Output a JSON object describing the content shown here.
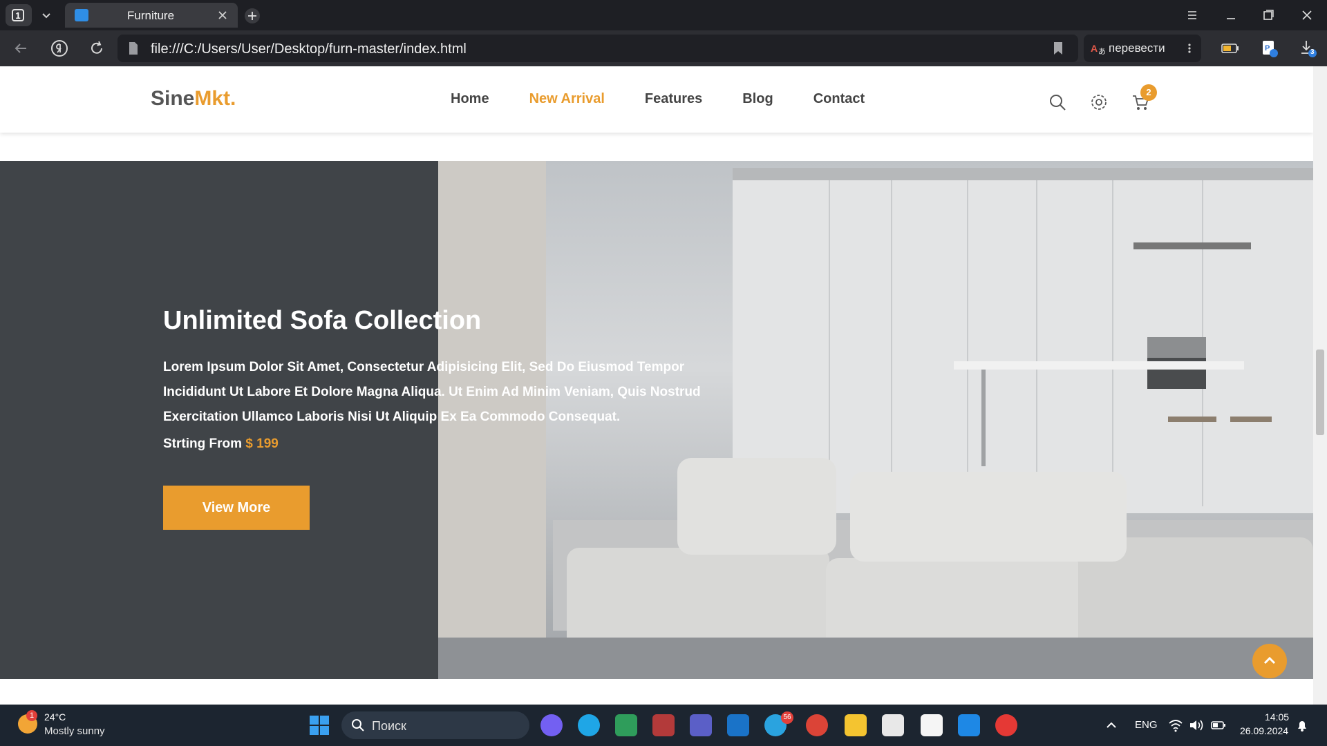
{
  "browser": {
    "tab_count": "1",
    "tab_title": "Furniture",
    "url": "file:///C:/Users/User/Desktop/furn-master/index.html",
    "translate_label": "перевести",
    "download_count": "3"
  },
  "site": {
    "logo_main": "Sine",
    "logo_accent": "Mkt",
    "logo_dot": ".",
    "nav": [
      "Home",
      "New Arrival",
      "Features",
      "Blog",
      "Contact"
    ],
    "active_nav": "New Arrival",
    "cart_count": "2"
  },
  "hero": {
    "title": "Unlimited Sofa Collection",
    "description": "Lorem Ipsum Dolor Sit Amet, Consectetur Adipisicing Elit, Sed Do Eiusmod Tempor Incididunt Ut Labore Et Dolore Magna Aliqua. Ut Enim Ad Minim Veniam, Quis Nostrud Exercitation Ullamco Laboris Nisi Ut Aliquip Ex Ea Commodo Consequat.",
    "price_prefix": "Strting From",
    "price": "$ 199",
    "button_label": "View More"
  },
  "taskbar": {
    "weather_temp": "24°C",
    "weather_desc": "Mostly sunny",
    "weather_badge": "1",
    "search_label": "Поиск",
    "telegram_badge": "56",
    "language": "ENG",
    "time": "14:05",
    "date": "26.09.2024"
  },
  "colors": {
    "accent": "#e99c2e",
    "hero_panel": "#404448",
    "tabbar": "#1e1f24",
    "taskbar": "#1c2530"
  }
}
